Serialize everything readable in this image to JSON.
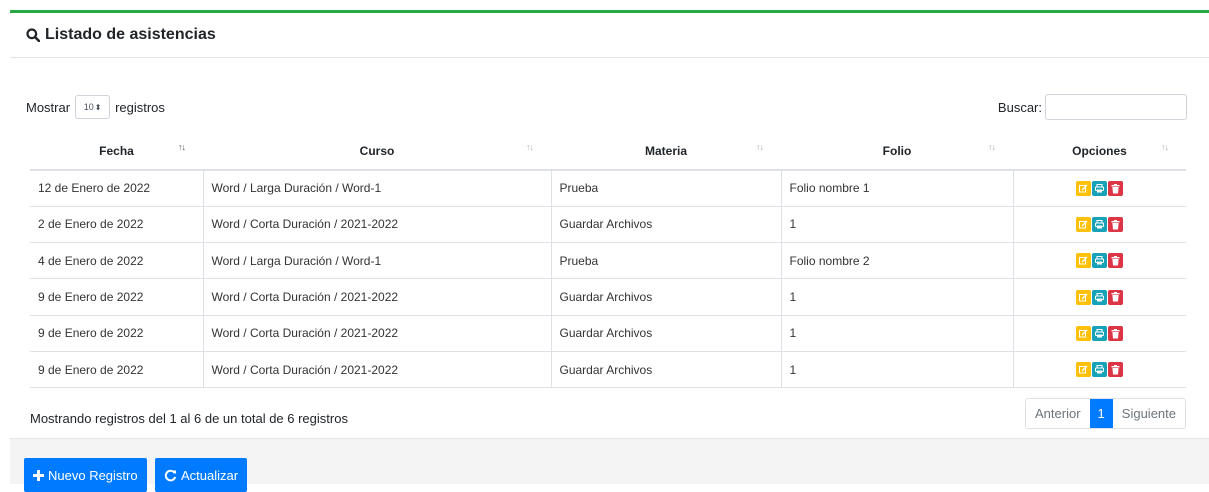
{
  "header": {
    "title": "Listado de asistencias",
    "icon": "search-icon"
  },
  "controls": {
    "show_label": "Mostrar",
    "show_value": "10",
    "records_label": "registros",
    "search_label": "Buscar:",
    "search_value": ""
  },
  "table": {
    "columns": [
      "Fecha",
      "Curso",
      "Materia",
      "Folio",
      "Opciones"
    ],
    "rows": [
      {
        "fecha": "12 de Enero de 2022",
        "curso": "Word / Larga Duración / Word-1",
        "materia": "Prueba",
        "folio": "Folio nombre 1"
      },
      {
        "fecha": "2 de Enero de 2022",
        "curso": "Word / Corta Duración / 2021-2022",
        "materia": "Guardar Archivos",
        "folio": "1"
      },
      {
        "fecha": "4 de Enero de 2022",
        "curso": "Word / Larga Duración / Word-1",
        "materia": "Prueba",
        "folio": "Folio nombre 2"
      },
      {
        "fecha": "9 de Enero de 2022",
        "curso": "Word / Corta Duración / 2021-2022",
        "materia": "Guardar Archivos",
        "folio": "1"
      },
      {
        "fecha": "9 de Enero de 2022",
        "curso": "Word / Corta Duración / 2021-2022",
        "materia": "Guardar Archivos",
        "folio": "1"
      },
      {
        "fecha": "9 de Enero de 2022",
        "curso": "Word / Corta Duración / 2021-2022",
        "materia": "Guardar Archivos",
        "folio": "1"
      }
    ]
  },
  "info": "Mostrando registros del 1 al 6 de un total de 6 registros",
  "pagination": {
    "prev": "Anterior",
    "current": "1",
    "next": "Siguiente"
  },
  "footer": {
    "new_label": "Nuevo Registro",
    "refresh_label": "Actualizar"
  },
  "colors": {
    "accent": "#28a745",
    "primary": "#007bff",
    "edit": "#ffc107",
    "print": "#17a2b8",
    "delete": "#dc3545"
  }
}
